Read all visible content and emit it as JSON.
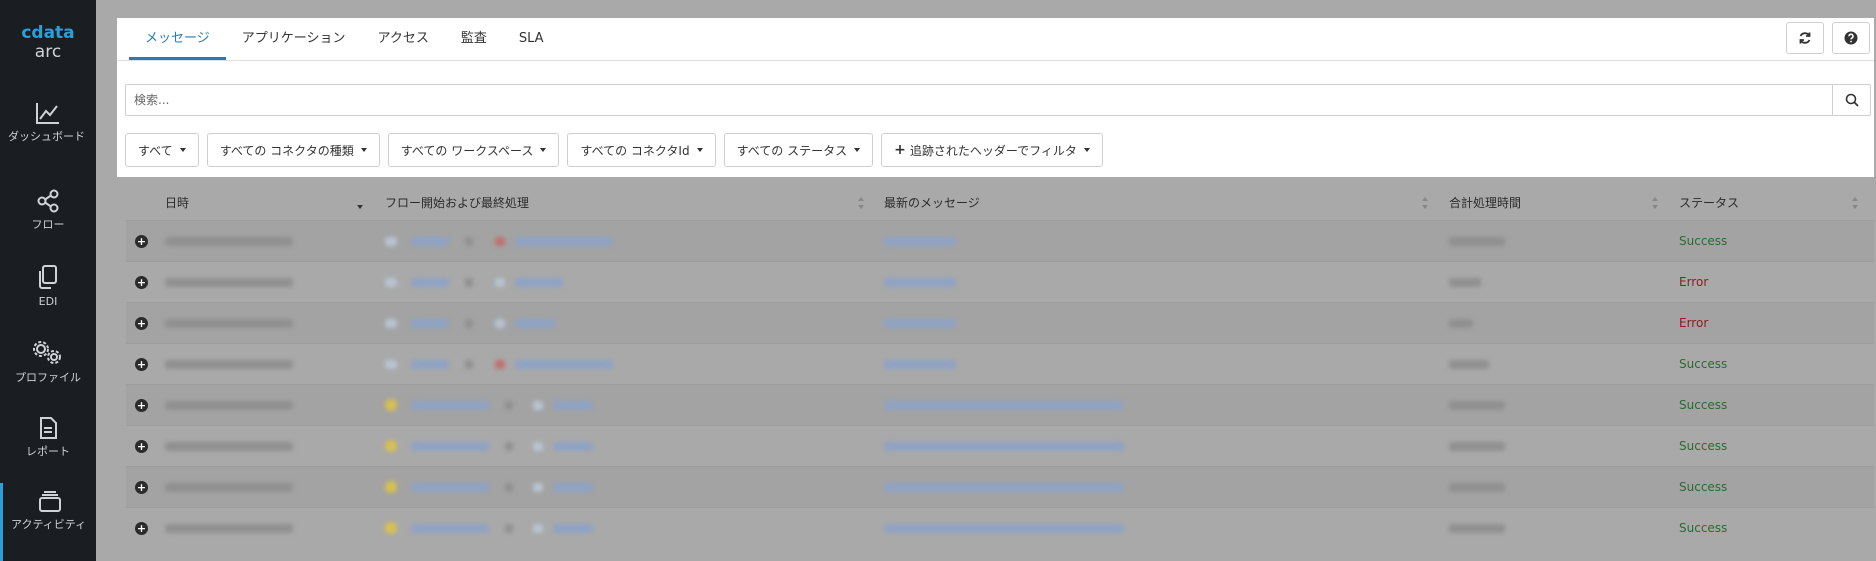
{
  "app": {
    "logo_top": "cdata",
    "logo_bottom": "arc"
  },
  "sidebar": {
    "items": [
      {
        "label": "ダッシュボード",
        "icon": "chart-line-icon"
      },
      {
        "label": "フロー",
        "icon": "share-nodes-icon"
      },
      {
        "label": "EDI",
        "icon": "copy-files-icon"
      },
      {
        "label": "プロファイル",
        "icon": "gears-icon"
      },
      {
        "label": "レポート",
        "icon": "document-icon"
      },
      {
        "label": "アクティビティ",
        "icon": "inbox-stack-icon"
      }
    ]
  },
  "tabs": [
    {
      "label": "メッセージ"
    },
    {
      "label": "アプリケーション"
    },
    {
      "label": "アクセス"
    },
    {
      "label": "監査"
    },
    {
      "label": "SLA"
    }
  ],
  "search": {
    "placeholder": "検索..."
  },
  "filters": [
    {
      "label": "すべて"
    },
    {
      "label": "すべての コネクタの種類"
    },
    {
      "label": "すべての ワークスペース"
    },
    {
      "label": "すべての コネクタId"
    },
    {
      "label": "すべての ステータス"
    },
    {
      "label": "追跡されたヘッダーでフィルタ"
    }
  ],
  "table": {
    "columns": [
      "日時",
      "フロー開始および最終処理",
      "最新のメッセージ",
      "合計処理時間",
      "ステータス"
    ],
    "rows": [
      {
        "status": "Success"
      },
      {
        "status": "Error"
      },
      {
        "status": "Error"
      },
      {
        "status": "Success"
      },
      {
        "status": "Success"
      },
      {
        "status": "Success"
      },
      {
        "status": "Success"
      },
      {
        "status": "Success"
      }
    ]
  },
  "colors": {
    "accent": "#2a7ab8",
    "sidebar_bg": "#1a1e23",
    "success": "#2a6b30",
    "error": "#8a2020"
  }
}
